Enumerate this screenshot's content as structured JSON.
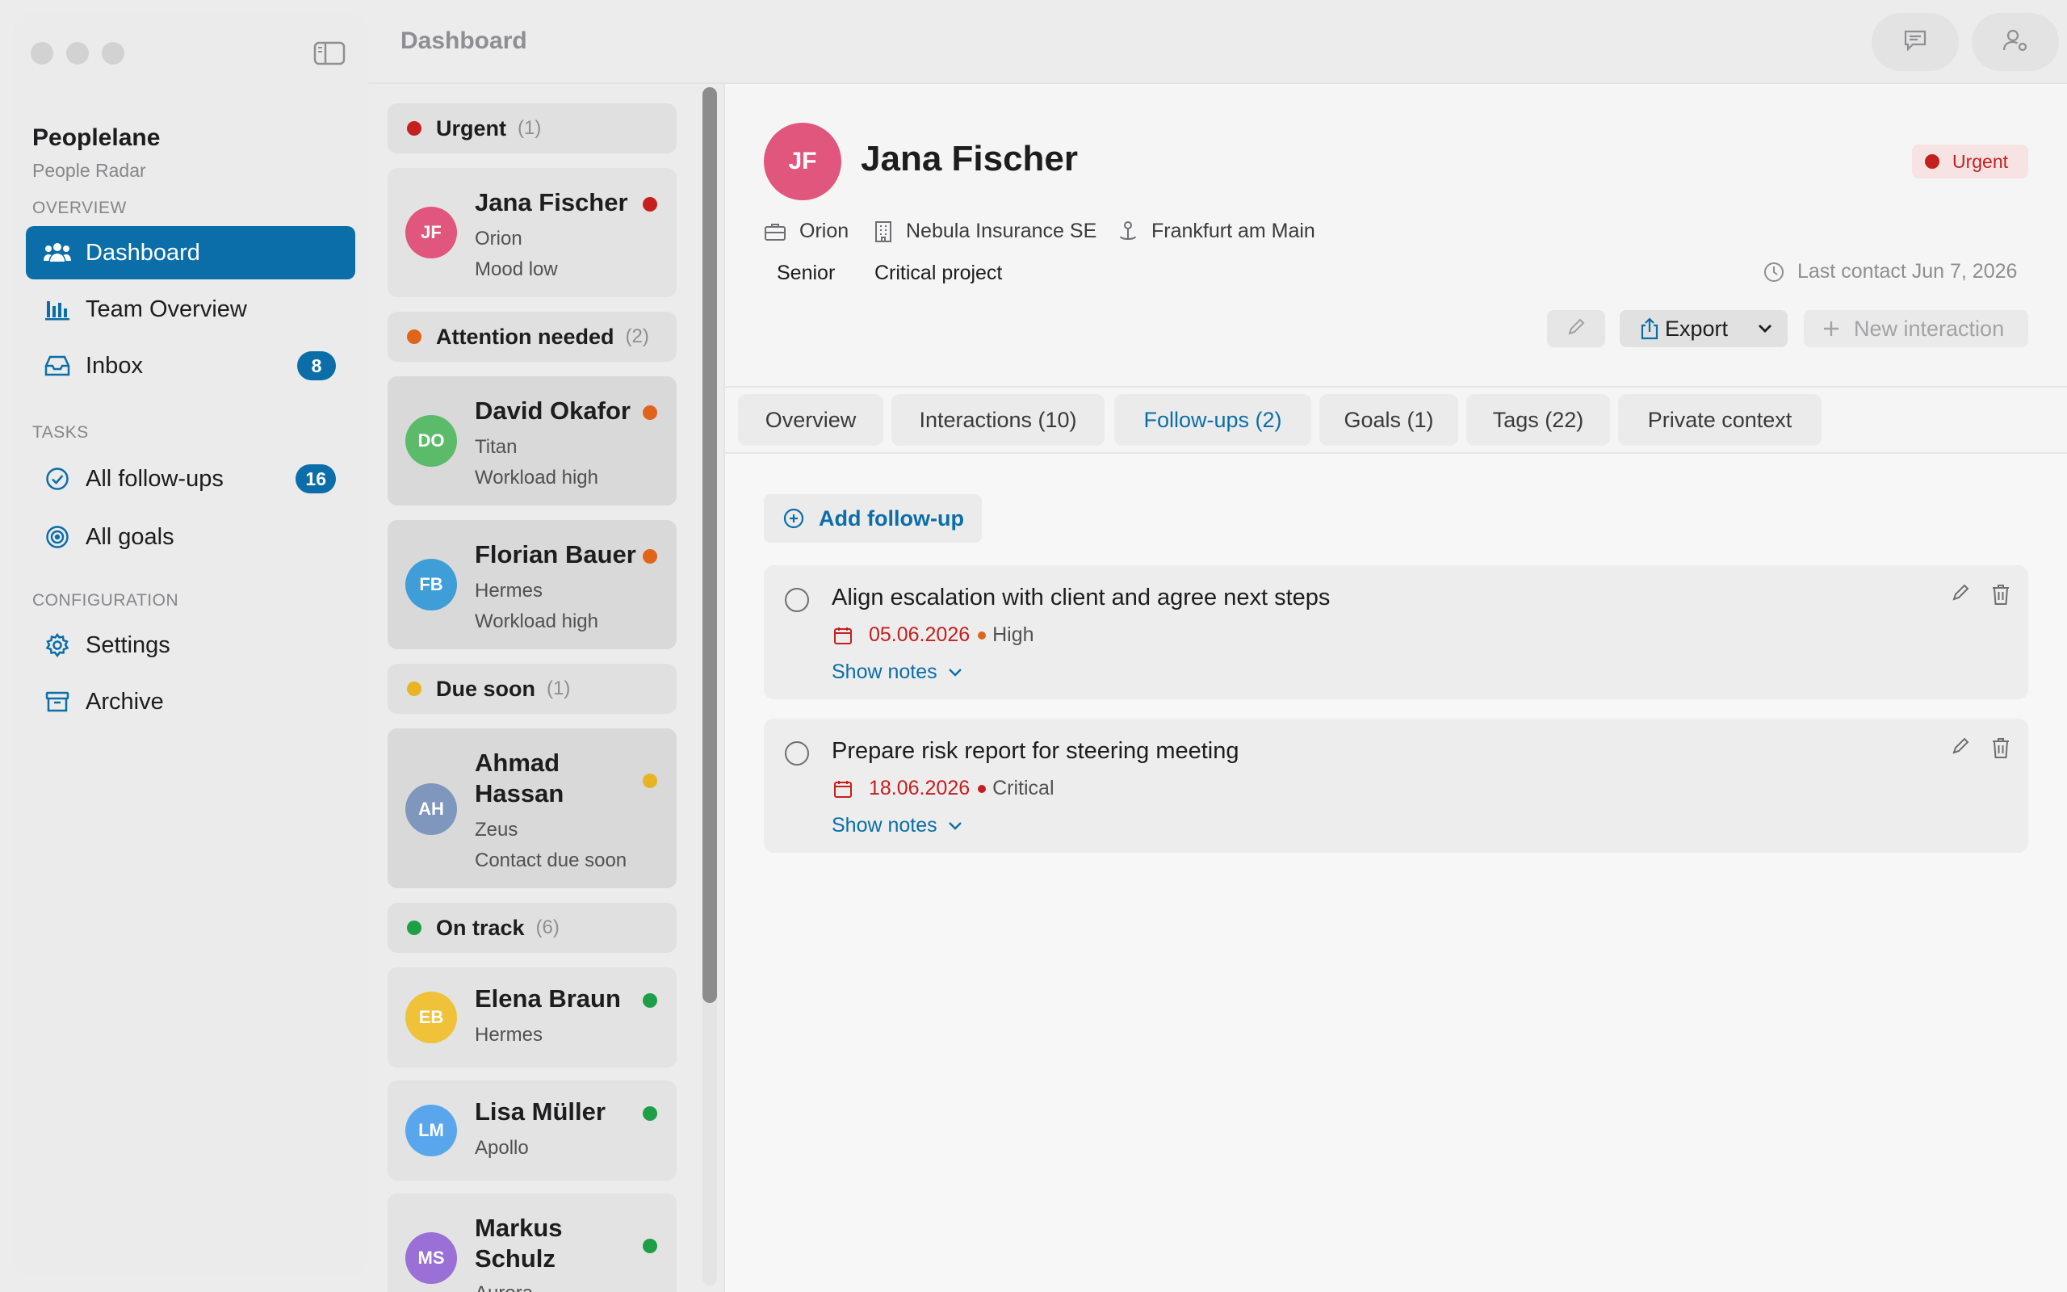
{
  "app": {
    "name": "Peoplelane",
    "subtitle": "People Radar"
  },
  "topbar": {
    "title": "Dashboard",
    "chat_icon": "chat-bubble-icon",
    "profile_icon": "person-gear-icon"
  },
  "sidebar": {
    "sections": {
      "overview": "OVERVIEW",
      "tasks": "TASKS",
      "configuration": "CONFIGURATION"
    },
    "items": [
      {
        "label": "Dashboard",
        "icon": "people-icon",
        "active": true
      },
      {
        "label": "Team Overview",
        "icon": "bar-chart-icon"
      },
      {
        "label": "Inbox",
        "icon": "inbox-icon",
        "badge": "8"
      },
      {
        "label": "All follow-ups",
        "icon": "check-circle-icon",
        "badge": "16"
      },
      {
        "label": "All goals",
        "icon": "target-icon"
      },
      {
        "label": "Settings",
        "icon": "gear-icon"
      },
      {
        "label": "Archive",
        "icon": "archive-box-icon"
      }
    ]
  },
  "people_list": {
    "groups": [
      {
        "label": "Urgent",
        "count": "(1)",
        "color": "#c42020"
      },
      {
        "label": "Attention needed",
        "count": "(2)",
        "color": "#e0651a"
      },
      {
        "label": "Due soon",
        "count": "(1)",
        "color": "#e8b423"
      },
      {
        "label": "On track",
        "count": "(6)",
        "color": "#1f9e48"
      }
    ],
    "people": [
      {
        "initials": "JF",
        "name": "Jana Fischer",
        "team": "Orion",
        "status": "Mood low",
        "avatar_color": "#e0567d",
        "dot_color": "#c42020"
      },
      {
        "initials": "DO",
        "name": "David Okafor",
        "team": "Titan",
        "status": "Workload high",
        "avatar_color": "#5cbb6a",
        "dot_color": "#e0651a"
      },
      {
        "initials": "FB",
        "name": "Florian Bauer",
        "team": "Hermes",
        "status": "Workload high",
        "avatar_color": "#3f9dd8",
        "dot_color": "#e0651a"
      },
      {
        "initials": "AH",
        "name": "Ahmad Hassan",
        "team": "Zeus",
        "status": "Contact due soon",
        "avatar_color": "#7f97bd",
        "dot_color": "#e8b423"
      },
      {
        "initials": "EB",
        "name": "Elena Braun",
        "team": "Hermes",
        "status": "",
        "avatar_color": "#efc23a",
        "dot_color": "#1f9e48"
      },
      {
        "initials": "LM",
        "name": "Lisa Müller",
        "team": "Apollo",
        "status": "",
        "avatar_color": "#5aa6ec",
        "dot_color": "#1f9e48"
      },
      {
        "initials": "MS",
        "name": "Markus Schulz",
        "team": "Aurora",
        "status": "",
        "avatar_color": "#9a6fd6",
        "dot_color": "#1f9e48"
      }
    ]
  },
  "detail": {
    "initials": "JF",
    "name": "Jana Fischer",
    "status_label": "Urgent",
    "team": "Orion",
    "company": "Nebula Insurance SE",
    "location": "Frankfurt am Main",
    "level": "Senior",
    "tag": "Critical project",
    "last_contact": "Last contact Jun 7, 2026",
    "export_label": "Export",
    "new_interaction_label": "New interaction",
    "tabs": [
      {
        "label": "Overview"
      },
      {
        "label": "Interactions (10)"
      },
      {
        "label": "Follow-ups (2)",
        "active": true
      },
      {
        "label": "Goals (1)"
      },
      {
        "label": "Tags (22)"
      },
      {
        "label": "Private context"
      }
    ],
    "add_followup_label": "Add follow-up",
    "followups": [
      {
        "title": "Align escalation with client and agree next steps",
        "date": "05.06.2026",
        "priority": "High",
        "priority_color": "#e0651a",
        "notes_label": "Show notes"
      },
      {
        "title": "Prepare risk report for steering meeting",
        "date": "18.06.2026",
        "priority": "Critical",
        "priority_color": "#c42020",
        "notes_label": "Show notes"
      }
    ]
  }
}
